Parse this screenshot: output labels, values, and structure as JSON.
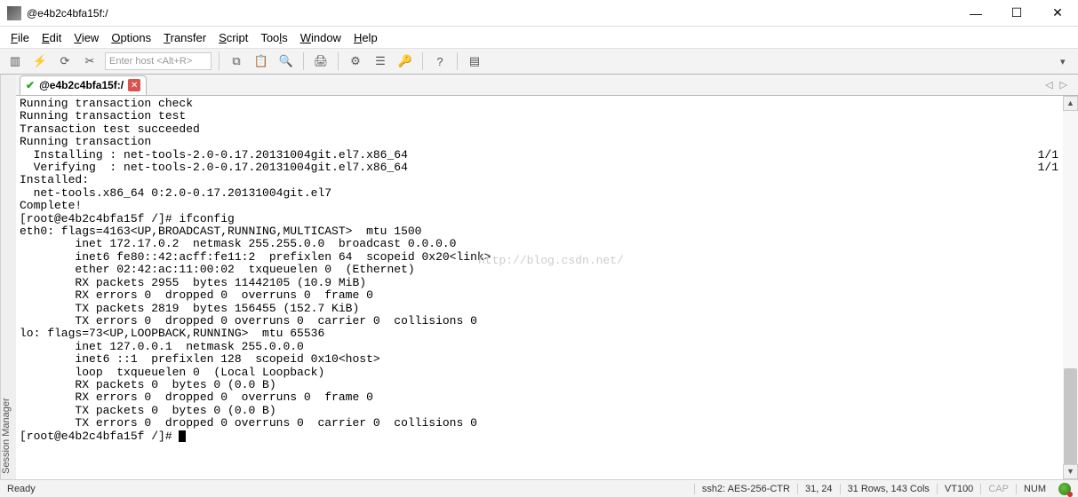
{
  "titlebar": {
    "title": "@e4b2c4bfa15f:/"
  },
  "menubar": {
    "file": "File",
    "edit": "Edit",
    "view": "View",
    "options": "Options",
    "transfer": "Transfer",
    "script": "Script",
    "tools": "Tools",
    "window": "Window",
    "help": "Help"
  },
  "toolbar": {
    "host_placeholder": "Enter host <Alt+R>"
  },
  "sidebar": {
    "label": "Session Manager"
  },
  "tab": {
    "label": "@e4b2c4bfa15f:/"
  },
  "terminal": {
    "lines": [
      "Running transaction check",
      "Running transaction test",
      "Transaction test succeeded",
      "Running transaction",
      "  Installing : net-tools-2.0-0.17.20131004git.el7.x86_64",
      "  Verifying  : net-tools-2.0-0.17.20131004git.el7.x86_64",
      "",
      "Installed:",
      "  net-tools.x86_64 0:2.0-0.17.20131004git.el7",
      "",
      "Complete!",
      "[root@e4b2c4bfa15f /]# ifconfig",
      "eth0: flags=4163<UP,BROADCAST,RUNNING,MULTICAST>  mtu 1500",
      "        inet 172.17.0.2  netmask 255.255.0.0  broadcast 0.0.0.0",
      "        inet6 fe80::42:acff:fe11:2  prefixlen 64  scopeid 0x20<link>",
      "        ether 02:42:ac:11:00:02  txqueuelen 0  (Ethernet)",
      "        RX packets 2955  bytes 11442105 (10.9 MiB)",
      "        RX errors 0  dropped 0  overruns 0  frame 0",
      "        TX packets 2819  bytes 156455 (152.7 KiB)",
      "        TX errors 0  dropped 0 overruns 0  carrier 0  collisions 0",
      "",
      "lo: flags=73<UP,LOOPBACK,RUNNING>  mtu 65536",
      "        inet 127.0.0.1  netmask 255.0.0.0",
      "        inet6 ::1  prefixlen 128  scopeid 0x10<host>",
      "        loop  txqueuelen 0  (Local Loopback)",
      "        RX packets 0  bytes 0 (0.0 B)",
      "        RX errors 0  dropped 0  overruns 0  frame 0",
      "        TX packets 0  bytes 0 (0.0 B)",
      "        TX errors 0  dropped 0 overruns 0  carrier 0  collisions 0",
      "",
      "[root@e4b2c4bfa15f /]# "
    ],
    "right_marks": {
      "4": "1/1",
      "5": "1/1"
    },
    "watermark": "http://blog.csdn.net/"
  },
  "statusbar": {
    "ready": "Ready",
    "cipher": "ssh2: AES-256-CTR",
    "cursor": "31,  24",
    "size": "31 Rows, 143 Cols",
    "term": "VT100",
    "cap": "CAP",
    "num": "NUM"
  }
}
